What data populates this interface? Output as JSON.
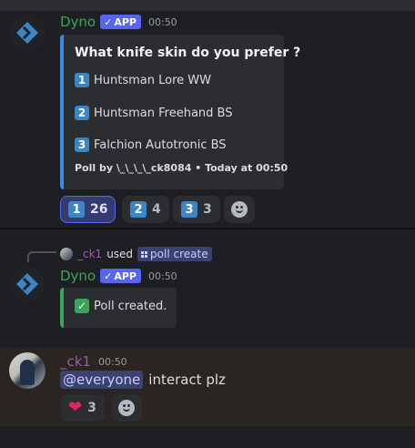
{
  "message1": {
    "author": "Dyno",
    "badge": "APP",
    "time": "00:50",
    "embed": {
      "title": "What knife skin do you prefer ?",
      "options": [
        {
          "num": "1",
          "label": "Huntsman Lore WW"
        },
        {
          "num": "2",
          "label": "Huntsman Freehand BS"
        },
        {
          "num": "3",
          "label": "Falchion Autotronic BS"
        }
      ],
      "footer": "Poll by \\_\\_\\_\\_ck8084 • Today at 00:50"
    },
    "reactions": [
      {
        "emoji": "1",
        "count": "26",
        "active": true
      },
      {
        "emoji": "2",
        "count": "4",
        "active": false
      },
      {
        "emoji": "3",
        "count": "3",
        "active": false
      }
    ]
  },
  "command": {
    "user": "_ck1",
    "used": "used",
    "command": "poll create"
  },
  "message2": {
    "author": "Dyno",
    "badge": "APP",
    "time": "00:50",
    "embed_text": "Poll created."
  },
  "message3": {
    "author": "_ck1",
    "time": "00:50",
    "mention": "@everyone",
    "text": "interact plz",
    "reaction": {
      "emoji": "heart-icon",
      "count": "3"
    }
  },
  "colors": {
    "dyno_name": "#3ba55c",
    "user_name": "#9b59b6",
    "app_badge": "#5865f2",
    "poll_border": "#3c8ad8",
    "created_border": "#3ba55c"
  }
}
